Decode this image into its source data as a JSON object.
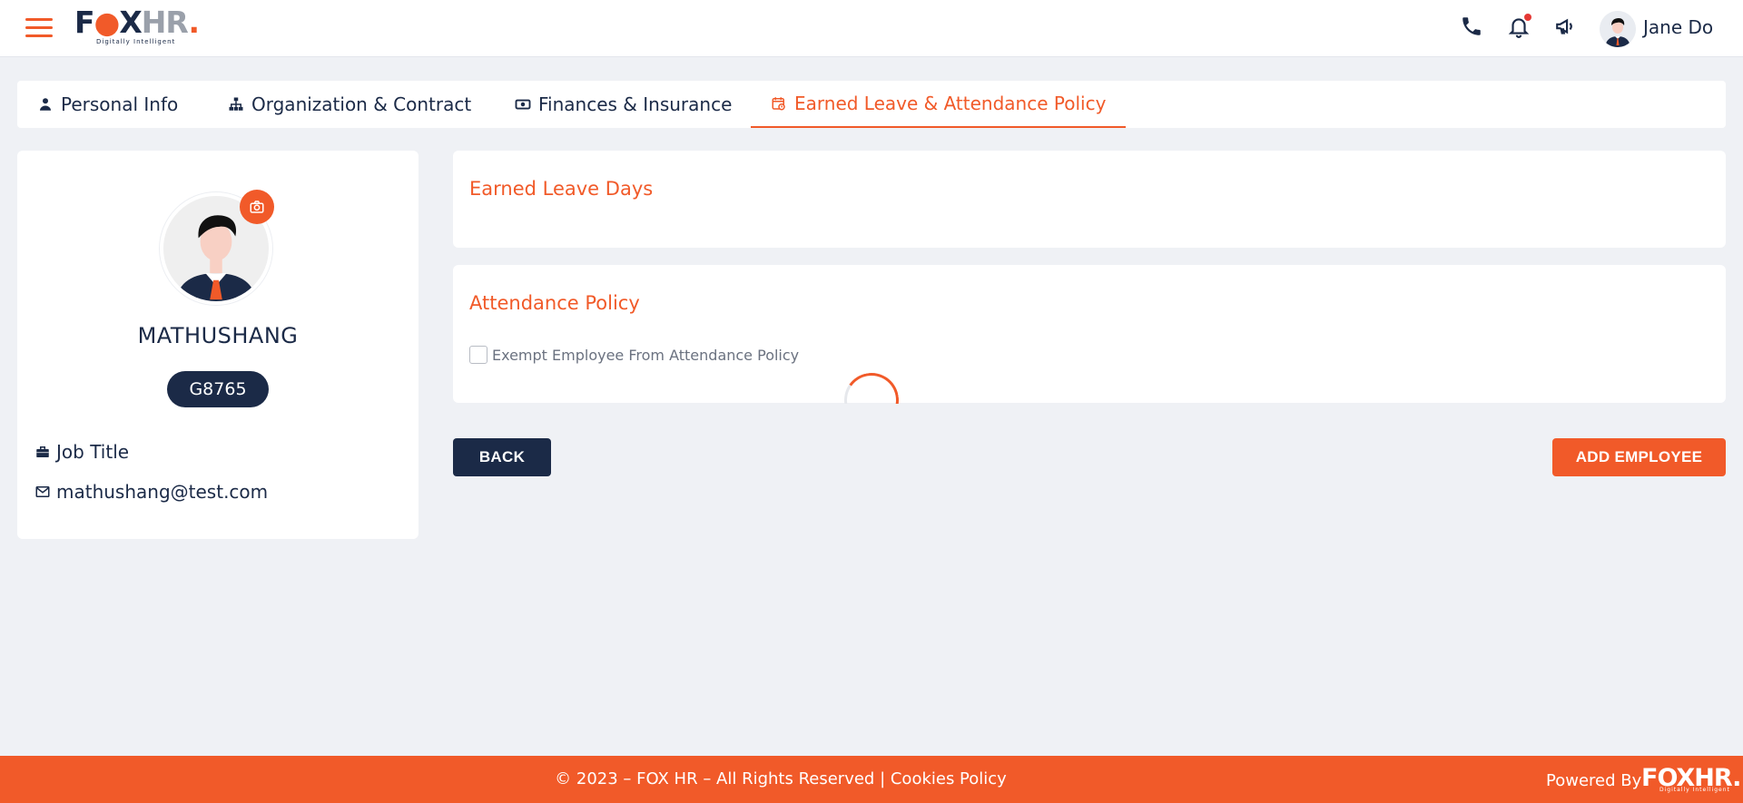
{
  "header": {
    "logo_main": "FOX",
    "logo_hr": "HR",
    "logo_tagline": "Digitally Intelligent",
    "user_name": "Jane Do"
  },
  "tabs": [
    {
      "label": "Personal Info",
      "icon": "person-icon"
    },
    {
      "label": "Organization & Contract",
      "icon": "org-chart-icon"
    },
    {
      "label": "Finances & Insurance",
      "icon": "money-icon"
    },
    {
      "label": "Earned Leave & Attendance Policy",
      "icon": "calendar-clock-icon",
      "active": true
    }
  ],
  "profile": {
    "name": "MATHUSHANG",
    "employee_id": "G8765",
    "job_title": "Job Title",
    "email": "mathushang@test.com"
  },
  "earned_leave": {
    "title": "Earned Leave Days"
  },
  "attendance": {
    "title": "Attendance Policy",
    "exempt_label": "Exempt Employee From Attendance Policy",
    "exempt_checked": false
  },
  "actions": {
    "back_label": "BACK",
    "add_label": "ADD EMPLOYEE"
  },
  "footer": {
    "copyright": "© 2023 – FOX HR – All Rights Reserved | ",
    "cookies": "Cookies Policy",
    "powered_by": "Powered By",
    "logo": "FOXHR.",
    "logo_tagline": "Digitally Intelligent"
  },
  "colors": {
    "accent": "#f15a29",
    "navy": "#1b2a47",
    "background": "#eff1f5"
  }
}
